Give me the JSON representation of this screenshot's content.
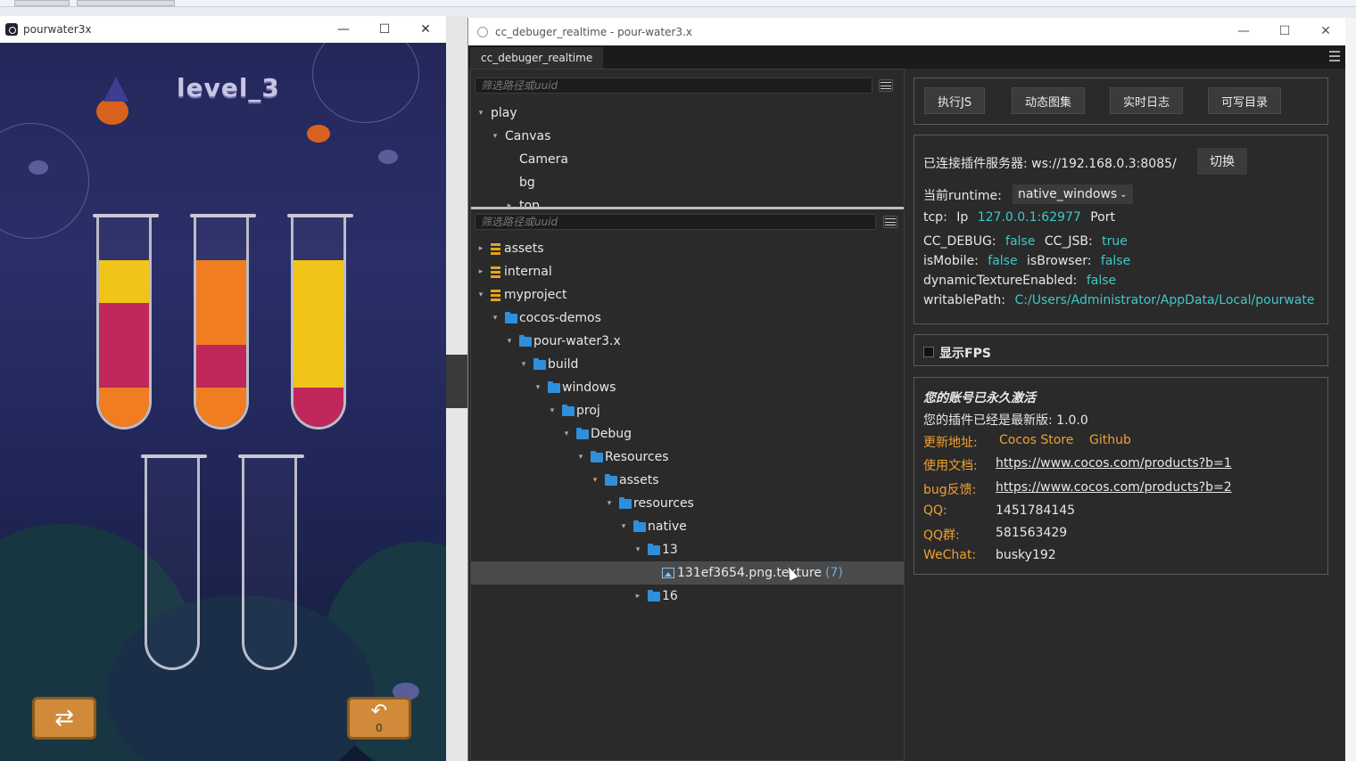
{
  "game_window": {
    "title": "pourwater3x",
    "level_label": "level_3",
    "tubes": [
      {
        "layers": [
          {
            "color": "#f0c419",
            "fraction": 0.25
          },
          {
            "color": "#c0275a",
            "fraction": 0.5
          },
          {
            "color": "#f07d22",
            "fraction": 0.25
          }
        ]
      },
      {
        "layers": [
          {
            "color": "#f07d22",
            "fraction": 0.5
          },
          {
            "color": "#c0275a",
            "fraction": 0.25
          },
          {
            "color": "#f07d22",
            "fraction": 0.25
          }
        ]
      },
      {
        "layers": [
          {
            "color": "#f0c419",
            "fraction": 0.75
          },
          {
            "color": "#c0275a",
            "fraction": 0.25
          }
        ]
      },
      {
        "layers": []
      },
      {
        "layers": []
      }
    ],
    "undo_count": "0"
  },
  "debugger_window": {
    "title": "cc_debuger_realtime - pour-water3.x",
    "tab": "cc_debuger_realtime",
    "filter_placeholder": "筛选路径或uuid",
    "node_tree": [
      {
        "label": "play",
        "depth": 0,
        "expanded": true
      },
      {
        "label": "Canvas",
        "depth": 1,
        "expanded": true
      },
      {
        "label": "Camera",
        "depth": 2,
        "expanded": null
      },
      {
        "label": "bg",
        "depth": 2,
        "expanded": null
      },
      {
        "label": "top",
        "depth": 2,
        "expanded": false
      }
    ],
    "asset_tree": [
      {
        "label": "assets",
        "depth": 0,
        "kind": "db",
        "expanded": false
      },
      {
        "label": "internal",
        "depth": 0,
        "kind": "db",
        "expanded": false
      },
      {
        "label": "myproject",
        "depth": 0,
        "kind": "db",
        "expanded": true
      },
      {
        "label": "cocos-demos",
        "depth": 1,
        "kind": "folder",
        "expanded": true
      },
      {
        "label": "pour-water3.x",
        "depth": 2,
        "kind": "folder",
        "expanded": true
      },
      {
        "label": "build",
        "depth": 3,
        "kind": "folder",
        "expanded": true
      },
      {
        "label": "windows",
        "depth": 4,
        "kind": "folder",
        "expanded": true
      },
      {
        "label": "proj",
        "depth": 5,
        "kind": "folder",
        "expanded": true
      },
      {
        "label": "Debug",
        "depth": 6,
        "kind": "folder",
        "expanded": true
      },
      {
        "label": "Resources",
        "depth": 7,
        "kind": "folder",
        "expanded": true
      },
      {
        "label": "assets",
        "depth": 8,
        "kind": "folder",
        "expanded": true
      },
      {
        "label": "resources",
        "depth": 9,
        "kind": "folder",
        "expanded": true
      },
      {
        "label": "native",
        "depth": 10,
        "kind": "folder",
        "expanded": true
      },
      {
        "label": "13",
        "depth": 11,
        "kind": "folder",
        "expanded": true
      },
      {
        "label": "131ef3654.png.texture",
        "depth": 12,
        "kind": "image",
        "count": "(7)",
        "selected": true
      },
      {
        "label": "16",
        "depth": 11,
        "kind": "folder",
        "expanded": false
      }
    ],
    "actions": [
      "执行JS",
      "动态图集",
      "实时日志",
      "可写目录"
    ],
    "connection": {
      "server_label": "已连接插件服务器:",
      "server_value": "ws://192.168.0.3:8085/",
      "switch_label": "切换",
      "runtime_label": "当前runtime:",
      "runtime_value": "native_windows",
      "tcp_label": "tcp:",
      "ip_label": "Ip",
      "ip_value": "127.0.0.1:62977",
      "port_label": "Port",
      "cc_debug_label": "CC_DEBUG:",
      "cc_debug_value": "false",
      "cc_jsb_label": "CC_JSB:",
      "cc_jsb_value": "true",
      "is_mobile_label": "isMobile:",
      "is_mobile_value": "false",
      "is_browser_label": "isBrowser:",
      "is_browser_value": "false",
      "dyn_tex_label": "dynamicTextureEnabled:",
      "dyn_tex_value": "false",
      "writable_label": "writablePath:",
      "writable_value": "C:/Users/Administrator/AppData/Local/pourwate"
    },
    "fps_label": "显示FPS",
    "info": {
      "activated": "您的账号已永久激活",
      "version_text": "您的插件已经是最新版:",
      "version": "1.0.0",
      "update_label": "更新地址:",
      "update_links": [
        "Cocos Store",
        "Github"
      ],
      "docs_label": "使用文档:",
      "docs_url": "https://www.cocos.com/products?b=1",
      "bug_label": "bug反馈:",
      "bug_url": "https://www.cocos.com/products?b=2",
      "qq_label": "QQ:",
      "qq_value": "1451784145",
      "qqgroup_label": "QQ群:",
      "qqgroup_value": "581563429",
      "wechat_label": "WeChat:",
      "wechat_value": "busky192"
    }
  }
}
